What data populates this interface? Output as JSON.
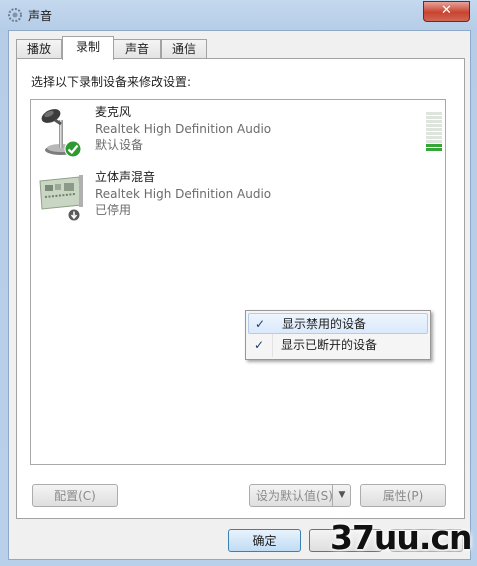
{
  "window": {
    "title": "声音",
    "close_glyph": "✕"
  },
  "tabs": [
    {
      "label": "播放"
    },
    {
      "label": "录制",
      "active": true
    },
    {
      "label": "声音"
    },
    {
      "label": "通信"
    }
  ],
  "panel": {
    "prompt": "选择以下录制设备来修改设置:"
  },
  "devices": [
    {
      "name": "麦克风",
      "driver": "Realtek High Definition Audio",
      "status": "默认设备",
      "icon": "microphone-icon",
      "badge": "green-check-icon",
      "level_fraction": 0.2
    },
    {
      "name": "立体声混音",
      "driver": "Realtek High Definition Audio",
      "status": "已停用",
      "icon": "sound-card-icon",
      "badge": "disabled-arrow-icon"
    }
  ],
  "context_menu": {
    "items": [
      {
        "label": "显示禁用的设备",
        "checked": true,
        "check_glyph": "✓"
      },
      {
        "label": "显示已断开的设备",
        "checked": true,
        "check_glyph": "✓"
      }
    ]
  },
  "buttons": {
    "configure": "配置(C)",
    "set_default": "设为默认值(S)",
    "set_default_arrow": "▼",
    "properties": "属性(P)",
    "ok": "确定"
  },
  "watermark": {
    "text": "37uu.cn"
  },
  "colors": {
    "accent": "#3c7fb1",
    "level_on": "#36a636",
    "close": "#c9432f"
  }
}
